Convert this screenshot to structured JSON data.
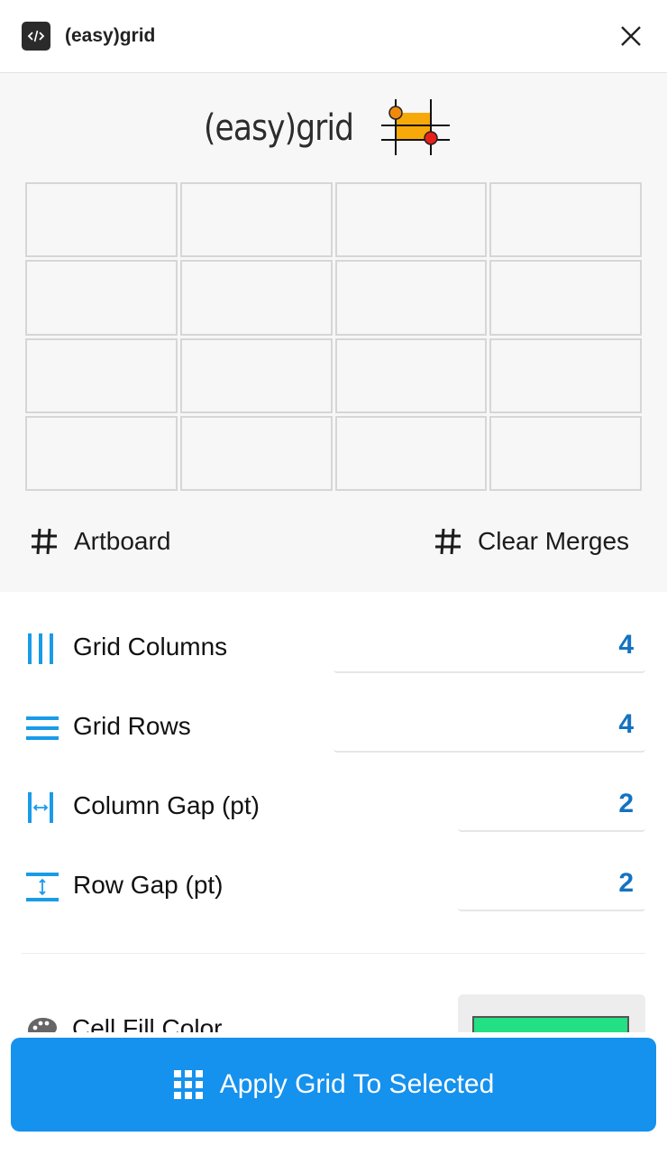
{
  "window": {
    "title": "(easy)grid",
    "icon": "code-icon",
    "close_icon": "close-icon"
  },
  "preview": {
    "logo_text": "(easy)grid",
    "grid": {
      "columns": 4,
      "rows": 4
    },
    "artboard_label": "Artboard",
    "clear_merges_label": "Clear Merges"
  },
  "settings": {
    "grid_columns": {
      "label": "Grid Columns",
      "value": "4",
      "icon": "columns-icon"
    },
    "grid_rows": {
      "label": "Grid Rows",
      "value": "4",
      "icon": "rows-icon"
    },
    "column_gap": {
      "label": "Column Gap (pt)",
      "value": "2",
      "icon": "column-gap-icon"
    },
    "row_gap": {
      "label": "Row Gap (pt)",
      "value": "2",
      "icon": "row-gap-icon"
    },
    "cell_fill": {
      "label": "Cell Fill Color",
      "color": "#22e083",
      "icon": "palette-icon"
    }
  },
  "apply_button": {
    "label": "Apply Grid To Selected",
    "icon": "grid-icon"
  },
  "colors": {
    "accent": "#1591ee",
    "value_text": "#1473c0",
    "icon_blue": "#1a9be8"
  }
}
